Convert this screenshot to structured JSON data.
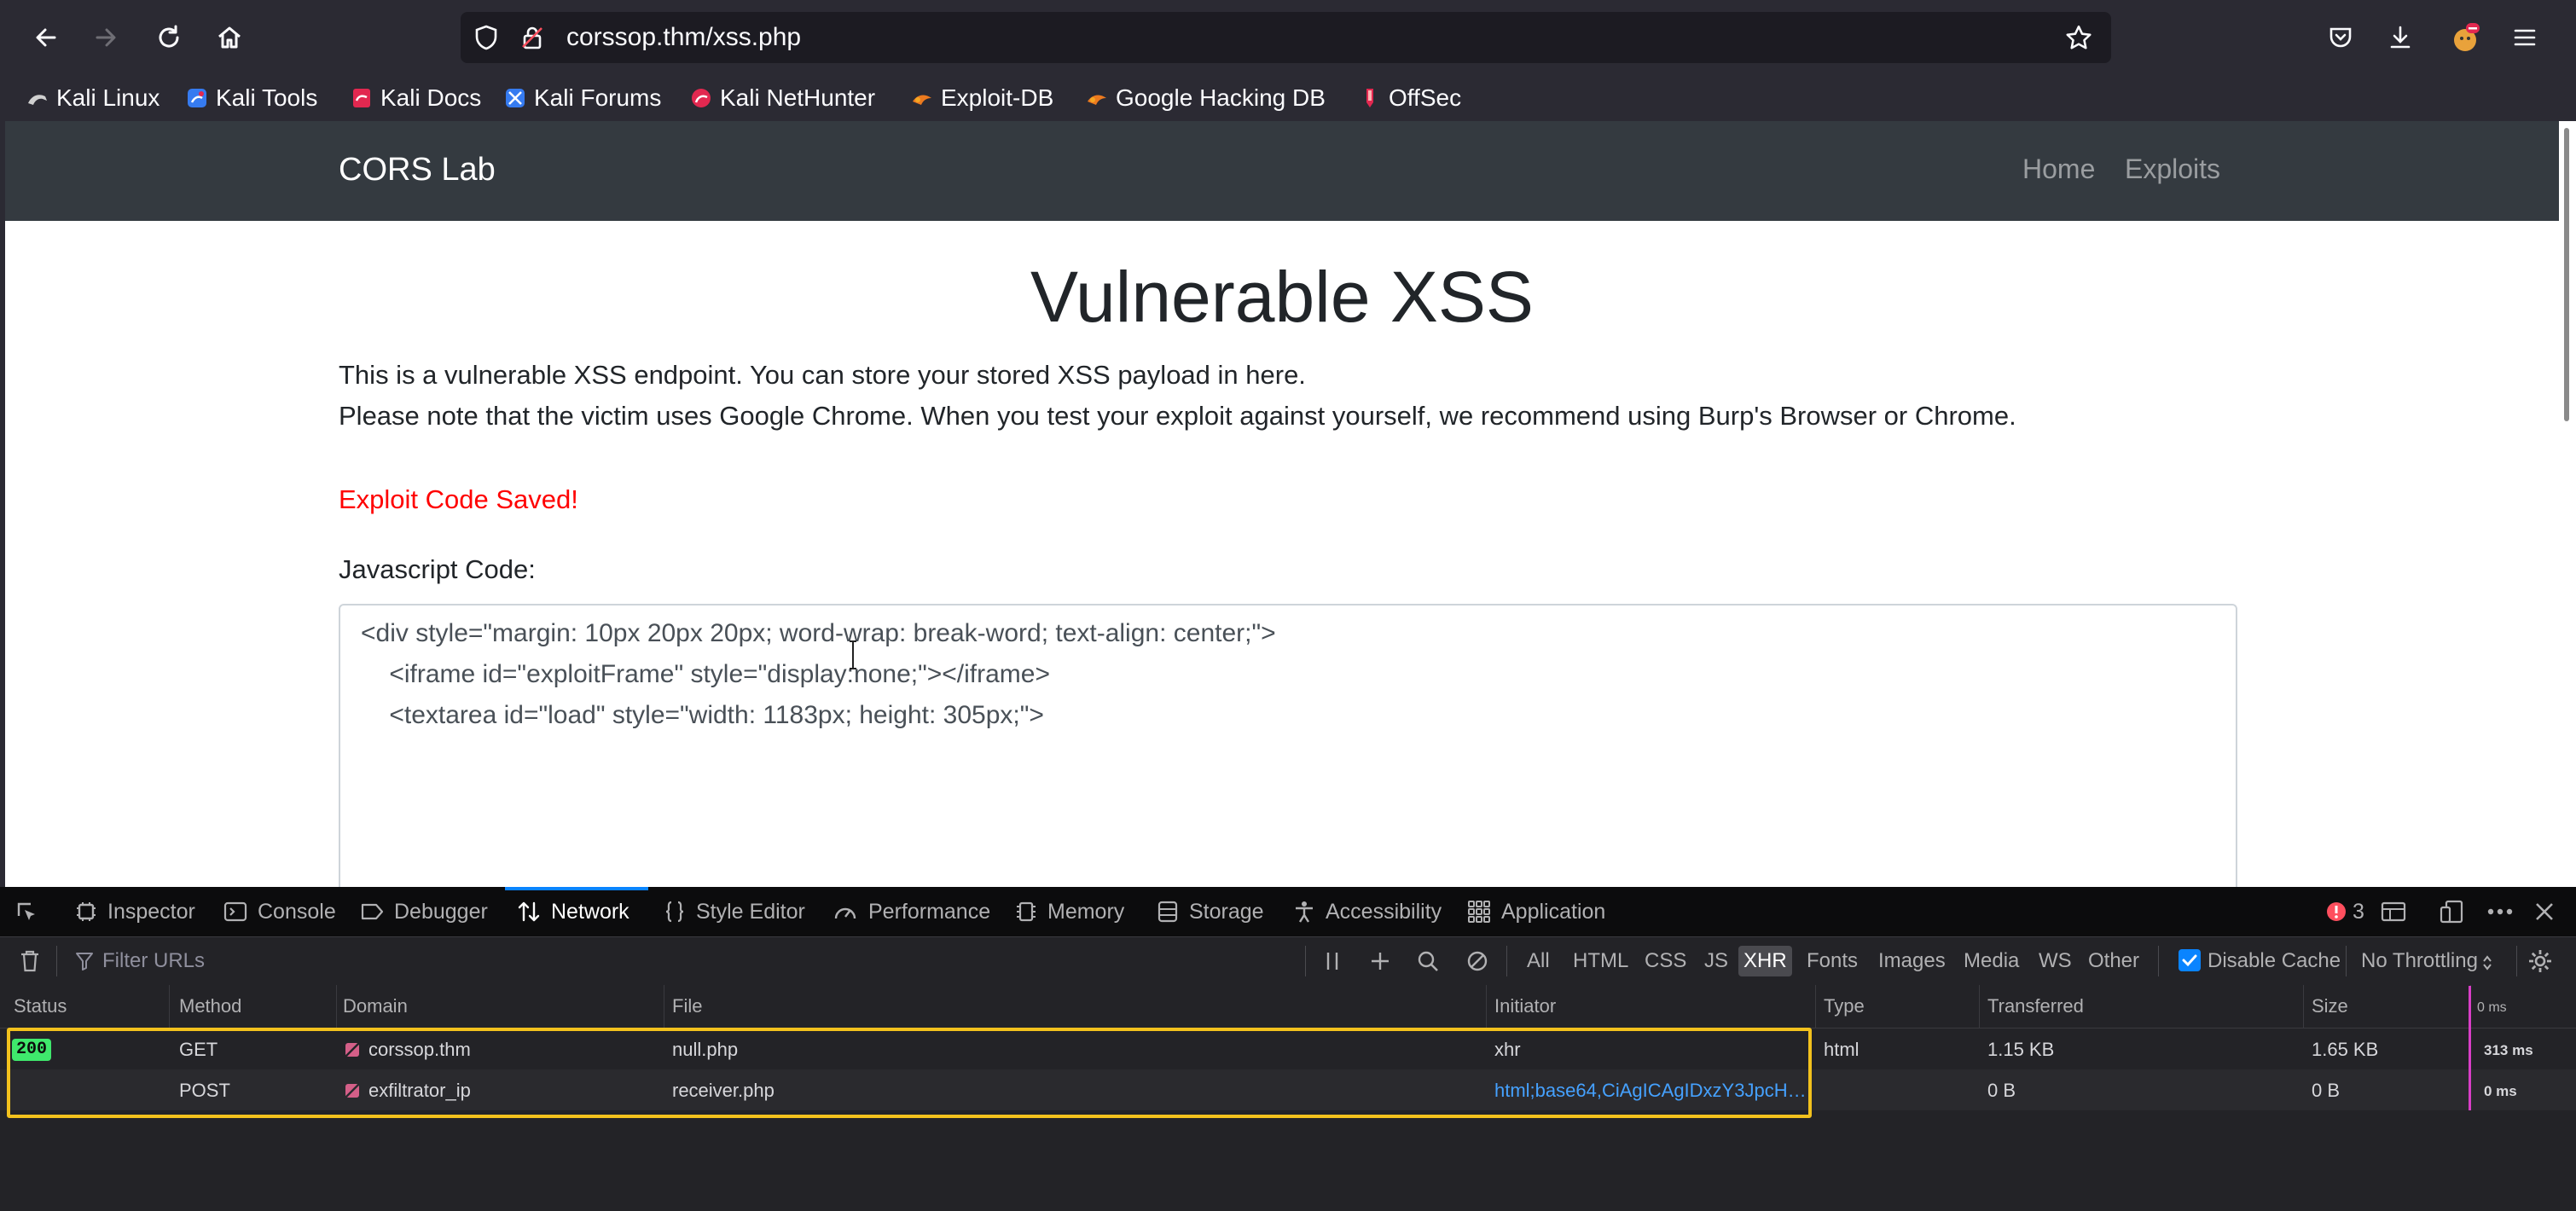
{
  "browser": {
    "url": "corssop.thm/xss.php",
    "bookmarks": [
      "Kali Linux",
      "Kali Tools",
      "Kali Docs",
      "Kali Forums",
      "Kali NetHunter",
      "Exploit-DB",
      "Google Hacking DB",
      "OffSec"
    ]
  },
  "site": {
    "brand": "CORS Lab",
    "nav": [
      "Home",
      "Exploits"
    ],
    "heading": "Vulnerable XSS",
    "paragraph1": "This is a vulnerable XSS endpoint. You can store your stored XSS payload in here.",
    "paragraph2": "Please note that the victim uses Google Chrome. When you test your exploit against yourself, we recommend using Burp's Browser or Chrome.",
    "saved_message": "Exploit Code Saved!",
    "code_label": "Javascript Code:",
    "code_lines": [
      "<div style=\"margin: 10px 20px 20px; word-wrap: break-word; text-align: center;\">",
      "    <iframe id=\"exploitFrame\" style=\"display:none;\"></iframe>",
      "    <textarea id=\"load\" style=\"width: 1183px; height: 305px;\">"
    ]
  },
  "devtools": {
    "tabs": [
      "Inspector",
      "Console",
      "Debugger",
      "Network",
      "Style Editor",
      "Performance",
      "Memory",
      "Storage",
      "Accessibility",
      "Application"
    ],
    "active_tab": "Network",
    "error_count": "3",
    "filter_placeholder": "Filter URLs",
    "type_filters": [
      "All",
      "HTML",
      "CSS",
      "JS",
      "XHR",
      "Fonts",
      "Images",
      "Media",
      "WS",
      "Other"
    ],
    "active_filter": "XHR",
    "disable_cache_label": "Disable Cache",
    "disable_cache_checked": true,
    "throttling": "No Throttling",
    "columns": [
      "Status",
      "Method",
      "Domain",
      "File",
      "Initiator",
      "Type",
      "Transferred",
      "Size",
      "0 ms"
    ],
    "rows": [
      {
        "status": "200",
        "method": "GET",
        "domain": "corssop.thm",
        "file": "null.php",
        "initiator": "xhr",
        "type": "html",
        "transferred": "1.15 KB",
        "size": "1.65 KB",
        "timing": "313 ms"
      },
      {
        "status": "",
        "method": "POST",
        "domain": "exfiltrator_ip",
        "file": "receiver.php",
        "initiator": "html;base64,CiAgICAgIDxzY3JpcH…",
        "type": "",
        "transferred": "0 B",
        "size": "0 B",
        "timing": "0 ms"
      }
    ]
  },
  "colors": {
    "highlight": "#f2c11d",
    "status_ok": "#3fe86c",
    "saved_message": "#ff0000",
    "site_navbar": "#343a40"
  }
}
